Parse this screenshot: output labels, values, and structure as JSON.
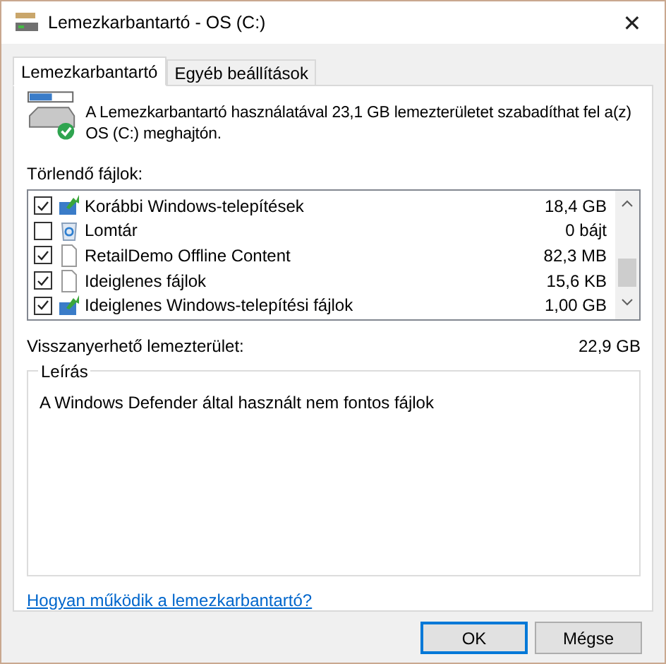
{
  "window": {
    "title": "Lemezkarbantartó - OS (C:)",
    "close": "✕"
  },
  "tabs": [
    {
      "label": "Lemezkarbantartó",
      "selected": true
    },
    {
      "label": "Egyéb beállítások",
      "selected": false
    }
  ],
  "intro": "A Lemezkarbantartó használatával 23,1 GB lemezterületet szabadíthat fel a(z) OS (C:) meghajtón.",
  "files_label": "Törlendő fájlok:",
  "files": [
    {
      "kind": "setup",
      "name": "Korábbi Windows-telepítések",
      "size": "18,4 GB",
      "checked": true
    },
    {
      "kind": "recycle",
      "name": "Lomtár",
      "size": "0 bájt",
      "checked": false
    },
    {
      "kind": "file",
      "name": "RetailDemo Offline Content",
      "size": "82,3 MB",
      "checked": true
    },
    {
      "kind": "file",
      "name": "Ideiglenes fájlok",
      "size": "15,6 KB",
      "checked": true
    },
    {
      "kind": "setup",
      "name": "Ideiglenes Windows-telepítési fájlok",
      "size": "1,00 GB",
      "checked": true
    }
  ],
  "recoverable": {
    "label": "Visszanyerhető lemezterület:",
    "value": "22,9 GB"
  },
  "description": {
    "title": "Leírás",
    "text": "A Windows Defender által használt nem fontos fájlok"
  },
  "help_link": "Hogyan működik a lemezkarbantartó?",
  "buttons": [
    {
      "label": "OK",
      "default": true
    },
    {
      "label": "Mégse",
      "default": false
    }
  ]
}
